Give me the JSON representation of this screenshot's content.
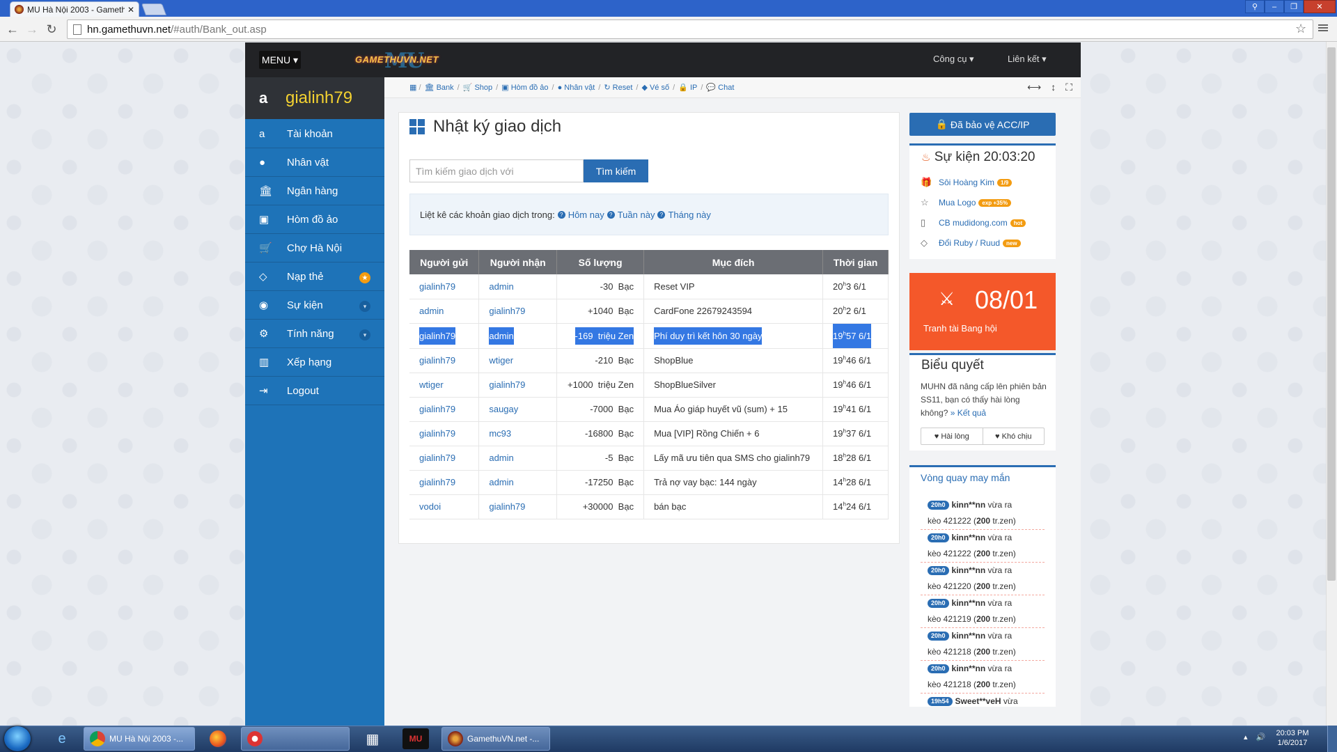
{
  "browser": {
    "tab_title": "MU Hà Nội 2003 - Gameth",
    "url_host": "hn.gamethuvn.net",
    "url_path": "/#auth/Bank_out.asp"
  },
  "header": {
    "menu_label": "MENU",
    "logo_text": "GAMETHUVN.NET",
    "logo_mark": "MU",
    "tools_label": "Công cụ",
    "links_label": "Liên kết"
  },
  "user": {
    "name": "gialinh79"
  },
  "sidebar": {
    "items": [
      {
        "label": "Tài khoản",
        "icon": "amazon-icon"
      },
      {
        "label": "Nhân vật",
        "icon": "user-icon"
      },
      {
        "label": "Ngân hàng",
        "icon": "bank-icon"
      },
      {
        "label": "Hòm đồ ảo",
        "icon": "briefcase-icon"
      },
      {
        "label": "Chợ Hà Nội",
        "icon": "cart-icon"
      },
      {
        "label": "Nạp thẻ",
        "icon": "diamond-icon"
      },
      {
        "label": "Sự kiện",
        "icon": "android-icon"
      },
      {
        "label": "Tính năng",
        "icon": "cogs-icon"
      },
      {
        "label": "Xếp hạng",
        "icon": "bar-chart-icon"
      },
      {
        "label": "Logout",
        "icon": "signout-icon"
      }
    ]
  },
  "breadcrumb": [
    "Bank",
    "Shop",
    "Hòm đồ ảo",
    "Nhân vật",
    "Reset",
    "Vé số",
    "IP",
    "Chat"
  ],
  "main": {
    "title": "Nhật ký giao dịch",
    "search_placeholder": "Tìm kiếm giao dịch với",
    "search_button": "Tìm kiếm",
    "filter_prefix": "Liệt kê các khoản giao dịch trong:",
    "filter_today": "Hôm nay",
    "filter_week": "Tuần này",
    "filter_month": "Tháng này"
  },
  "table": {
    "headers": [
      "Người gửi",
      "Người nhận",
      "Số lượng",
      "Mục đích",
      "Thời gian"
    ],
    "rows": [
      {
        "sender": "gialinh79",
        "receiver": "admin",
        "amount": "-30  Bạc",
        "purpose": "Reset VIP",
        "time_h": "20",
        "time_m": "3 6/1"
      },
      {
        "sender": "admin",
        "receiver": "gialinh79",
        "amount": "+1040  Bạc",
        "purpose": "CardFone 22679243594",
        "time_h": "20",
        "time_m": "2 6/1"
      },
      {
        "sender": "gialinh79",
        "receiver": "admin",
        "amount": "-169  triệu Zen",
        "purpose": "Phí duy trì kết hôn 30 ngày",
        "time_h": "19",
        "time_m": "57 6/1"
      },
      {
        "sender": "gialinh79",
        "receiver": "wtiger",
        "amount": "-210  Bạc",
        "purpose": "ShopBlue",
        "time_h": "19",
        "time_m": "46 6/1"
      },
      {
        "sender": "wtiger",
        "receiver": "gialinh79",
        "amount": "+1000  triệu Zen",
        "purpose": "ShopBlueSilver",
        "time_h": "19",
        "time_m": "46 6/1"
      },
      {
        "sender": "gialinh79",
        "receiver": "saugay",
        "amount": "-7000  Bạc",
        "purpose": "Mua Áo giáp huyết vũ (sum) + 15",
        "time_h": "19",
        "time_m": "41 6/1"
      },
      {
        "sender": "gialinh79",
        "receiver": "mc93",
        "amount": "-16800  Bạc",
        "purpose": "Mua [VIP] Rồng Chiến + 6",
        "time_h": "19",
        "time_m": "37 6/1"
      },
      {
        "sender": "gialinh79",
        "receiver": "admin",
        "amount": "-5  Bạc",
        "purpose": "Lấy mã ưu tiên qua SMS cho gialinh79",
        "time_h": "18",
        "time_m": "28 6/1"
      },
      {
        "sender": "gialinh79",
        "receiver": "admin",
        "amount": "-17250  Bạc",
        "purpose": "Trả nợ vay bạc: 144 ngày",
        "time_h": "14",
        "time_m": "28 6/1"
      },
      {
        "sender": "vodoi",
        "receiver": "gialinh79",
        "amount": "+30000  Bạc",
        "purpose": "bán bạc",
        "time_h": "14",
        "time_m": "24 6/1"
      }
    ],
    "time_sup": "h"
  },
  "right": {
    "protect_label": "Đã bảo vệ ACC/IP",
    "event_title": "Sự kiện 20:03:20",
    "events": [
      {
        "label": "Sôi Hoàng Kim",
        "badge": "1/9",
        "icon": "gift-icon"
      },
      {
        "label": "Mua Logo",
        "badge": "exp +35%",
        "icon": "star-icon"
      },
      {
        "label": "CB mudidong.com",
        "badge": "hot",
        "icon": "mobile-icon"
      },
      {
        "label": "Đổi Ruby / Ruud",
        "badge": "new",
        "icon": "diamond-icon"
      }
    ],
    "date_big": "08/01",
    "date_sub": "Tranh tài Bang hội",
    "poll_title": "Biểu quyết",
    "poll_text": "MUHN đã nâng cấp lên phiên bản SS11, bạn có thấy hài lòng không?",
    "poll_result": "» Kết quả",
    "poll_yes": "Hài lòng",
    "poll_no": "Khó chịu",
    "lucky_title": "Vòng quay may mắn",
    "lucky": [
      {
        "time": "20h0",
        "name": "kinn**nn",
        "text1": " vừa ra",
        "text2": "kèo 421222 (",
        "val": "200",
        "unit": " tr.zen)"
      },
      {
        "time": "20h0",
        "name": "kinn**nn",
        "text1": " vừa ra",
        "text2": "kèo 421222 (",
        "val": "200",
        "unit": " tr.zen)"
      },
      {
        "time": "20h0",
        "name": "kinn**nn",
        "text1": " vừa ra",
        "text2": "kèo 421220 (",
        "val": "200",
        "unit": " tr.zen)"
      },
      {
        "time": "20h0",
        "name": "kinn**nn",
        "text1": " vừa ra",
        "text2": "kèo 421219 (",
        "val": "200",
        "unit": " tr.zen)"
      },
      {
        "time": "20h0",
        "name": "kinn**nn",
        "text1": " vừa ra",
        "text2": "kèo 421218 (",
        "val": "200",
        "unit": " tr.zen)"
      },
      {
        "time": "20h0",
        "name": "kinn**nn",
        "text1": " vừa ra",
        "text2": "kèo 421218 (",
        "val": "200",
        "unit": " tr.zen)"
      },
      {
        "time": "19h54",
        "name": "Sweet**veH",
        "text1": " vừa",
        "text2": "",
        "val": "",
        "unit": ""
      }
    ]
  },
  "taskbar": {
    "task1": "MU Hà Nội 2003 -...",
    "task2": "GamethuVN.net -...",
    "clock_time": "20:03 PM",
    "clock_date": "1/6/2017"
  }
}
